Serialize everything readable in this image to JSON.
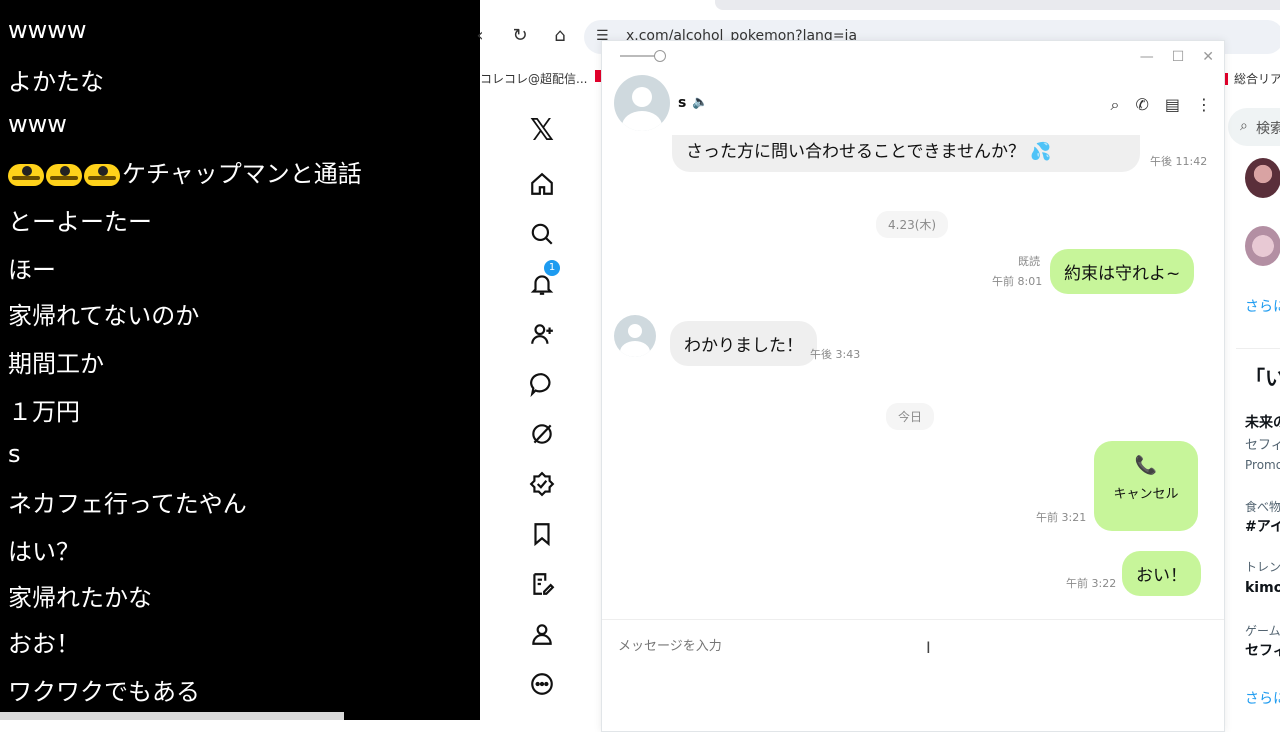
{
  "comments": [
    "wwww",
    "よかたな",
    "www",
    "ケチャップマンと通話",
    "とーよーたー",
    "ほー",
    "家帰れてないのか",
    "期間工か",
    "１万円",
    "s",
    "ネカフェ行ってたやん",
    "はい？",
    "家帰れたかな",
    "おお！",
    "ワクワクでもある"
  ],
  "browser": {
    "url": "x.com/alcohol_pokemon?lang=ja",
    "bookmark_left": "コレコレ@超配信...",
    "bookmark_right": "総合リア"
  },
  "sidebar": {
    "logo": "𝕏",
    "notification_count": "1"
  },
  "right_panel": {
    "search_placeholder": "検索",
    "more_link_1": "さらに",
    "trend_heading": "「い",
    "trend1_title": "未来の",
    "trend1_sub": "セフィ",
    "trend1_promo": "Promo",
    "trend2_category": "食べ物",
    "trend2_title": "#アイ",
    "trend3_category": "トレン",
    "trend3_title": "kimo",
    "trend4_category": "ゲーム",
    "trend4_title": "セフィ",
    "more_link_2": "さらに"
  },
  "dm": {
    "name": "s",
    "messages": {
      "m1_text": "さった方に問い合わせることできませんか？ 💦",
      "m1_time": "午後 11:42",
      "date1": "4.23(木)",
      "m2_read": "既読",
      "m2_time": "午前 8:01",
      "m2_text": "約束は守れよ~",
      "m3_text": "わかりました！",
      "m3_time": "午後 3:43",
      "date2": "今日",
      "m4_icon": "📞",
      "m4_text": "キャンセル",
      "m4_time": "午前 3:21",
      "m5_text": "おい！",
      "m5_time": "午前 3:22"
    },
    "composer_placeholder": "メッセージを入力"
  }
}
